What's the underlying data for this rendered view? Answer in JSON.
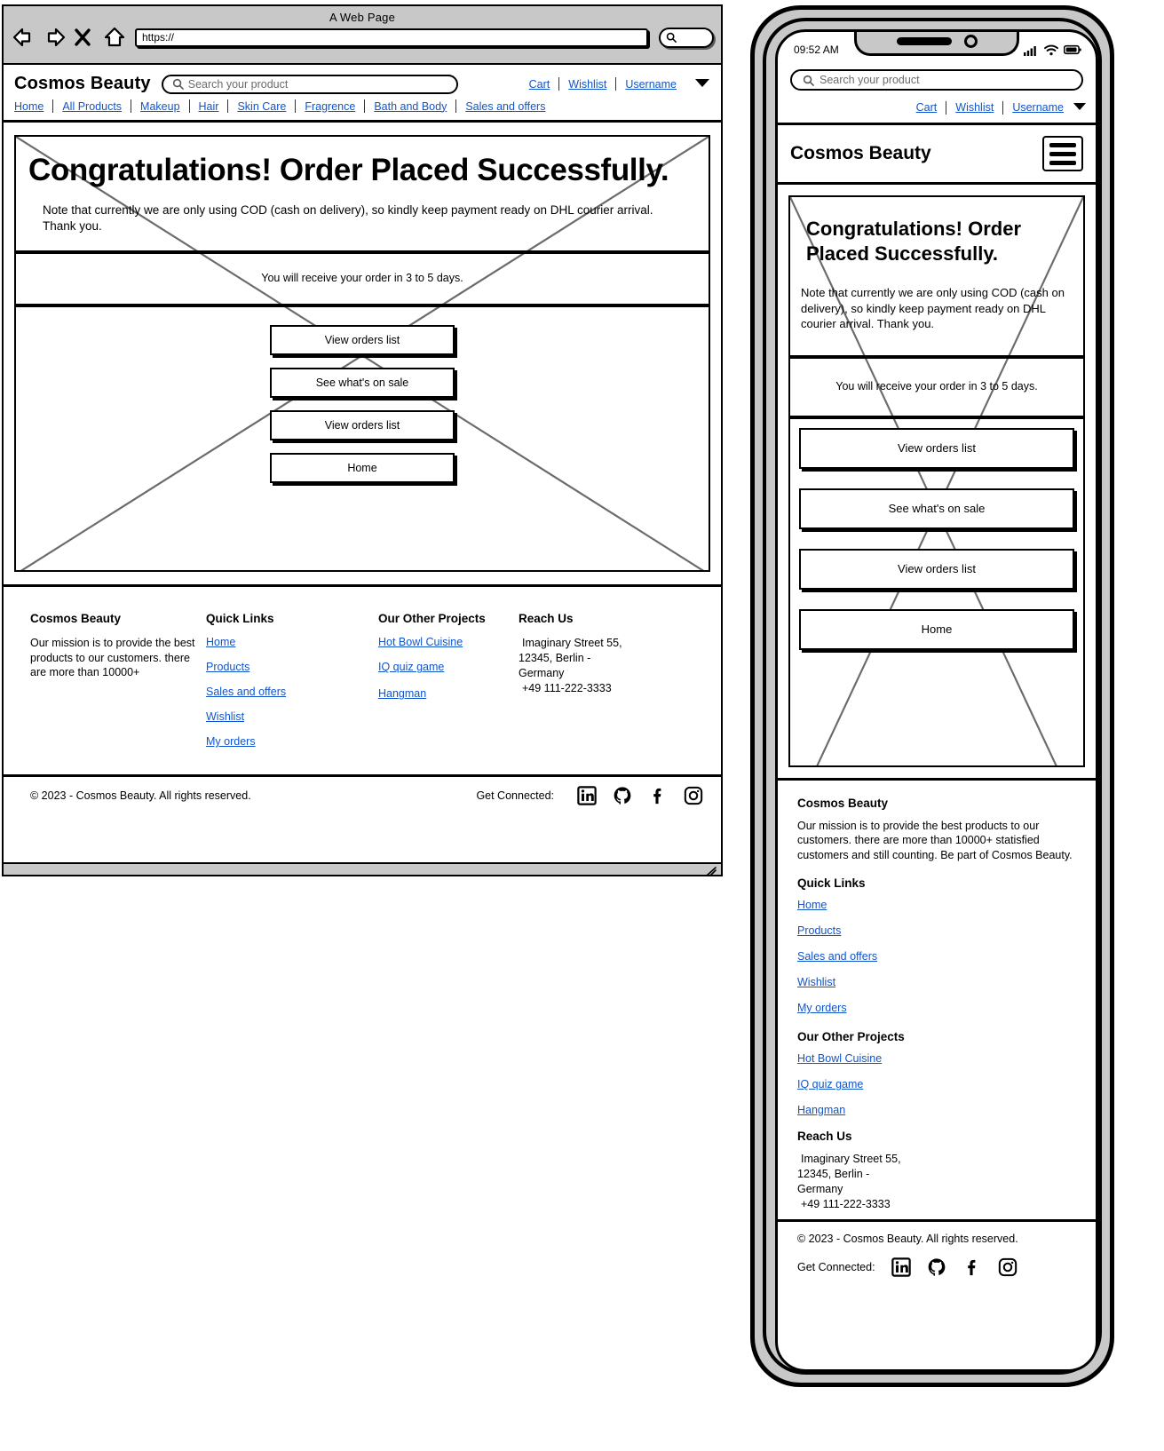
{
  "browser": {
    "title": "A Web Page",
    "url_value": "https://",
    "back_icon": "back-arrow-icon",
    "forward_icon": "forward-arrow-icon",
    "stop_icon": "close-x-icon",
    "home_icon": "home-icon",
    "search_icon": "search-icon"
  },
  "header": {
    "brand": "Cosmos Beauty",
    "search_placeholder": "Search your product",
    "links": [
      "Cart",
      "Wishlist",
      "Username"
    ],
    "caret": "▼"
  },
  "nav": {
    "items": [
      "Home",
      "All Products",
      "Makeup",
      "Hair",
      "Skin Care",
      "Fragrence",
      "Bath and Body",
      "Sales and offers"
    ]
  },
  "main": {
    "headline": "Congratulations! Order Placed Successfully.",
    "note": "Note that currently we are only using COD (cash on delivery), so kindly keep payment ready on DHL courier arrival. Thank you.",
    "eta": "You will receive your order in 3 to 5 days.",
    "buttons": [
      "View orders list",
      "See what's on sale",
      "View orders list",
      "Home"
    ]
  },
  "footer": {
    "brand_heading": "Cosmos Beauty",
    "mission_desktop": "Our mission is to provide the best products to our customers. there are more than 10000+",
    "mission_mobile": "Our mission is to provide the best products to our customers. there are more than 10000+ statisfied customers and still counting. Be part of Cosmos Beauty.",
    "quick_links_heading": "Quick Links",
    "quick_links": [
      "Home",
      "Products",
      "Sales and offers",
      "Wishlist",
      "My orders"
    ],
    "projects_heading": "Our Other Projects",
    "projects": [
      "Hot Bowl Cuisine",
      "IQ quiz game",
      "Hangman"
    ],
    "reach_heading": "Reach Us",
    "address_line1": "Imaginary Street 55,",
    "address_line2": "12345, Berlin -",
    "address_line3": "Germany",
    "phone": "+49 111-222-3333",
    "copyright": "© 2023 - Cosmos Beauty. All rights reserved.",
    "get_connected": "Get Connected:",
    "socials": [
      "linkedin-icon",
      "github-icon",
      "facebook-icon",
      "instagram-icon"
    ]
  },
  "phone": {
    "time": "09:52 AM",
    "signal_icon": "cellular-signal-icon",
    "wifi_icon": "wifi-icon",
    "battery_icon": "battery-icon",
    "menu_icon": "hamburger-menu-icon"
  }
}
